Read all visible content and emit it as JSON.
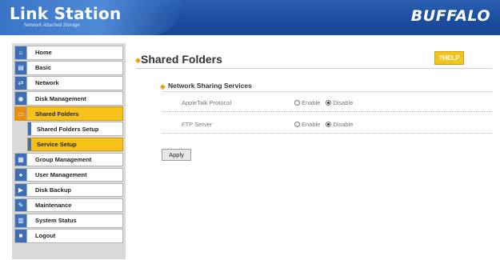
{
  "header": {
    "title": "Link Station",
    "subtitle": "Network Attached Storage",
    "vendor_logo": "BUFFALO"
  },
  "sidebar": {
    "items": [
      {
        "label": "Home",
        "icon": "home-icon"
      },
      {
        "label": "Basic",
        "icon": "basic-icon"
      },
      {
        "label": "Network",
        "icon": "network-icon"
      },
      {
        "label": "Disk Management",
        "icon": "disk-icon"
      },
      {
        "label": "Shared Folders",
        "icon": "folder-icon",
        "active": true
      },
      {
        "label": "Shared Folders Setup",
        "sub": true
      },
      {
        "label": "Service Setup",
        "sub": true,
        "active": true
      },
      {
        "label": "Group Management",
        "icon": "group-icon"
      },
      {
        "label": "User Management",
        "icon": "user-icon"
      },
      {
        "label": "Disk Backup",
        "icon": "backup-icon"
      },
      {
        "label": "Maintenance",
        "icon": "wrench-icon"
      },
      {
        "label": "System Status",
        "icon": "status-icon"
      },
      {
        "label": "Logout",
        "icon": "logout-icon"
      }
    ]
  },
  "main": {
    "title": "Shared Folders",
    "help_label": "?HELP",
    "section_title": "Network Sharing Services",
    "rows": [
      {
        "label": "AppleTalk Protocol",
        "enable": "Enable",
        "disable": "Disable",
        "selected": "disable"
      },
      {
        "label": "FTP Server",
        "enable": "Enable",
        "disable": "Disable",
        "selected": "disable"
      }
    ],
    "apply_label": "Apply"
  },
  "colors": {
    "header_blue": "#1d4f9f",
    "accent_yellow": "#f6c21a",
    "accent_orange": "#e58f12"
  }
}
